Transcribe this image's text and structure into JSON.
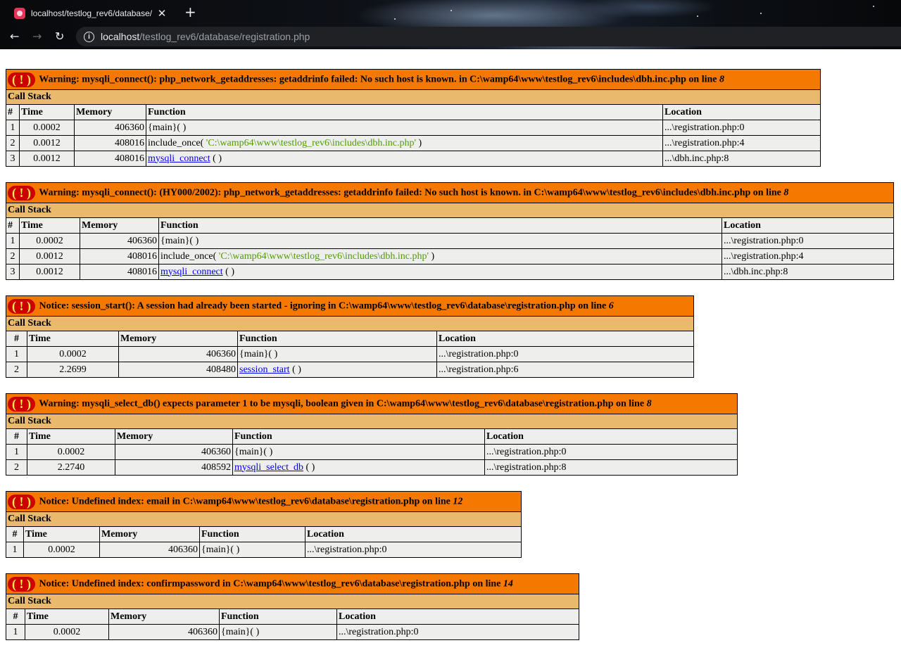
{
  "browser": {
    "tab_title": "localhost/testlog_rev6/database/",
    "url_host": "localhost",
    "url_path": "/testlog_rev6/database/registration.php"
  },
  "colors": {
    "error_header": "#f57900",
    "call_stack_header": "#e9b96e",
    "cell_background": "#eeeeec",
    "bang_badge": "#cc0000"
  },
  "errors": [
    {
      "bang": "( ! )",
      "message": "Warning: mysqli_connect(): php_network_getaddresses: getaddrinfo failed: No such host is known. in C:\\wamp64\\www\\testlog_rev6\\includes\\dbh.inc.php on line",
      "line": "8",
      "call_stack_label": "Call Stack",
      "columns": [
        "#",
        "Time",
        "Memory",
        "Function",
        "Location"
      ],
      "rows": [
        {
          "num": "1",
          "time": "0.0002",
          "memory": "406360",
          "func": "{main}( )",
          "location": "...\\registration.php:0"
        },
        {
          "num": "2",
          "time": "0.0012",
          "memory": "408016",
          "func": "include_once( ",
          "arg": "'C:\\wamp64\\www\\testlog_rev6\\includes\\dbh.inc.php'",
          "func_end": " )",
          "location": "...\\registration.php:4"
        },
        {
          "num": "3",
          "time": "0.0012",
          "memory": "408016",
          "func_link": "mysqli_connect",
          "func_end": " ( )",
          "location": "...\\dbh.inc.php:8"
        }
      ]
    },
    {
      "bang": "( ! )",
      "message": "Warning: mysqli_connect(): (HY000/2002): php_network_getaddresses: getaddrinfo failed: No such host is known. in C:\\wamp64\\www\\testlog_rev6\\includes\\dbh.inc.php on line",
      "line": "8",
      "call_stack_label": "Call Stack",
      "columns": [
        "#",
        "Time",
        "Memory",
        "Function",
        "Location"
      ],
      "rows": [
        {
          "num": "1",
          "time": "0.0002",
          "memory": "406360",
          "func": "{main}( )",
          "location": "...\\registration.php:0"
        },
        {
          "num": "2",
          "time": "0.0012",
          "memory": "408016",
          "func": "include_once( ",
          "arg": "'C:\\wamp64\\www\\testlog_rev6\\includes\\dbh.inc.php'",
          "func_end": " )",
          "location": "...\\registration.php:4"
        },
        {
          "num": "3",
          "time": "0.0012",
          "memory": "408016",
          "func_link": "mysqli_connect",
          "func_end": " ( )",
          "location": "...\\dbh.inc.php:8"
        }
      ]
    },
    {
      "bang": "( ! )",
      "message": "Notice: session_start(): A session had already been started - ignoring in C:\\wamp64\\www\\testlog_rev6\\database\\registration.php on line",
      "line": "6",
      "call_stack_label": "Call Stack",
      "columns": [
        "#",
        "Time",
        "Memory",
        "Function",
        "Location"
      ],
      "rows": [
        {
          "num": "1",
          "time": "0.0002",
          "memory": "406360",
          "func": "{main}( )",
          "location": "...\\registration.php:0"
        },
        {
          "num": "2",
          "time": "2.2699",
          "memory": "408480",
          "func_link": "session_start",
          "func_end": " ( )",
          "location": "...\\registration.php:6"
        }
      ]
    },
    {
      "bang": "( ! )",
      "message": "Warning: mysqli_select_db() expects parameter 1 to be mysqli, boolean given in C:\\wamp64\\www\\testlog_rev6\\database\\registration.php on line",
      "line": "8",
      "call_stack_label": "Call Stack",
      "columns": [
        "#",
        "Time",
        "Memory",
        "Function",
        "Location"
      ],
      "rows": [
        {
          "num": "1",
          "time": "0.0002",
          "memory": "406360",
          "func": "{main}( )",
          "location": "...\\registration.php:0"
        },
        {
          "num": "2",
          "time": "2.2740",
          "memory": "408592",
          "func_link": "mysqli_select_db",
          "func_end": " ( )",
          "location": "...\\registration.php:8"
        }
      ]
    },
    {
      "bang": "( ! )",
      "message": "Notice: Undefined index: email in C:\\wamp64\\www\\testlog_rev6\\database\\registration.php on line",
      "line": "12",
      "call_stack_label": "Call Stack",
      "columns": [
        "#",
        "Time",
        "Memory",
        "Function",
        "Location"
      ],
      "rows": [
        {
          "num": "1",
          "time": "0.0002",
          "memory": "406360",
          "func": "{main}( )",
          "location": "...\\registration.php:0"
        }
      ]
    },
    {
      "bang": "( ! )",
      "message": "Notice: Undefined index: confirmpassword in C:\\wamp64\\www\\testlog_rev6\\database\\registration.php on line",
      "line": "14",
      "call_stack_label": "Call Stack",
      "columns": [
        "#",
        "Time",
        "Memory",
        "Function",
        "Location"
      ],
      "rows": [
        {
          "num": "1",
          "time": "0.0002",
          "memory": "406360",
          "func": "{main}( )",
          "location": "...\\registration.php:0"
        }
      ]
    }
  ]
}
